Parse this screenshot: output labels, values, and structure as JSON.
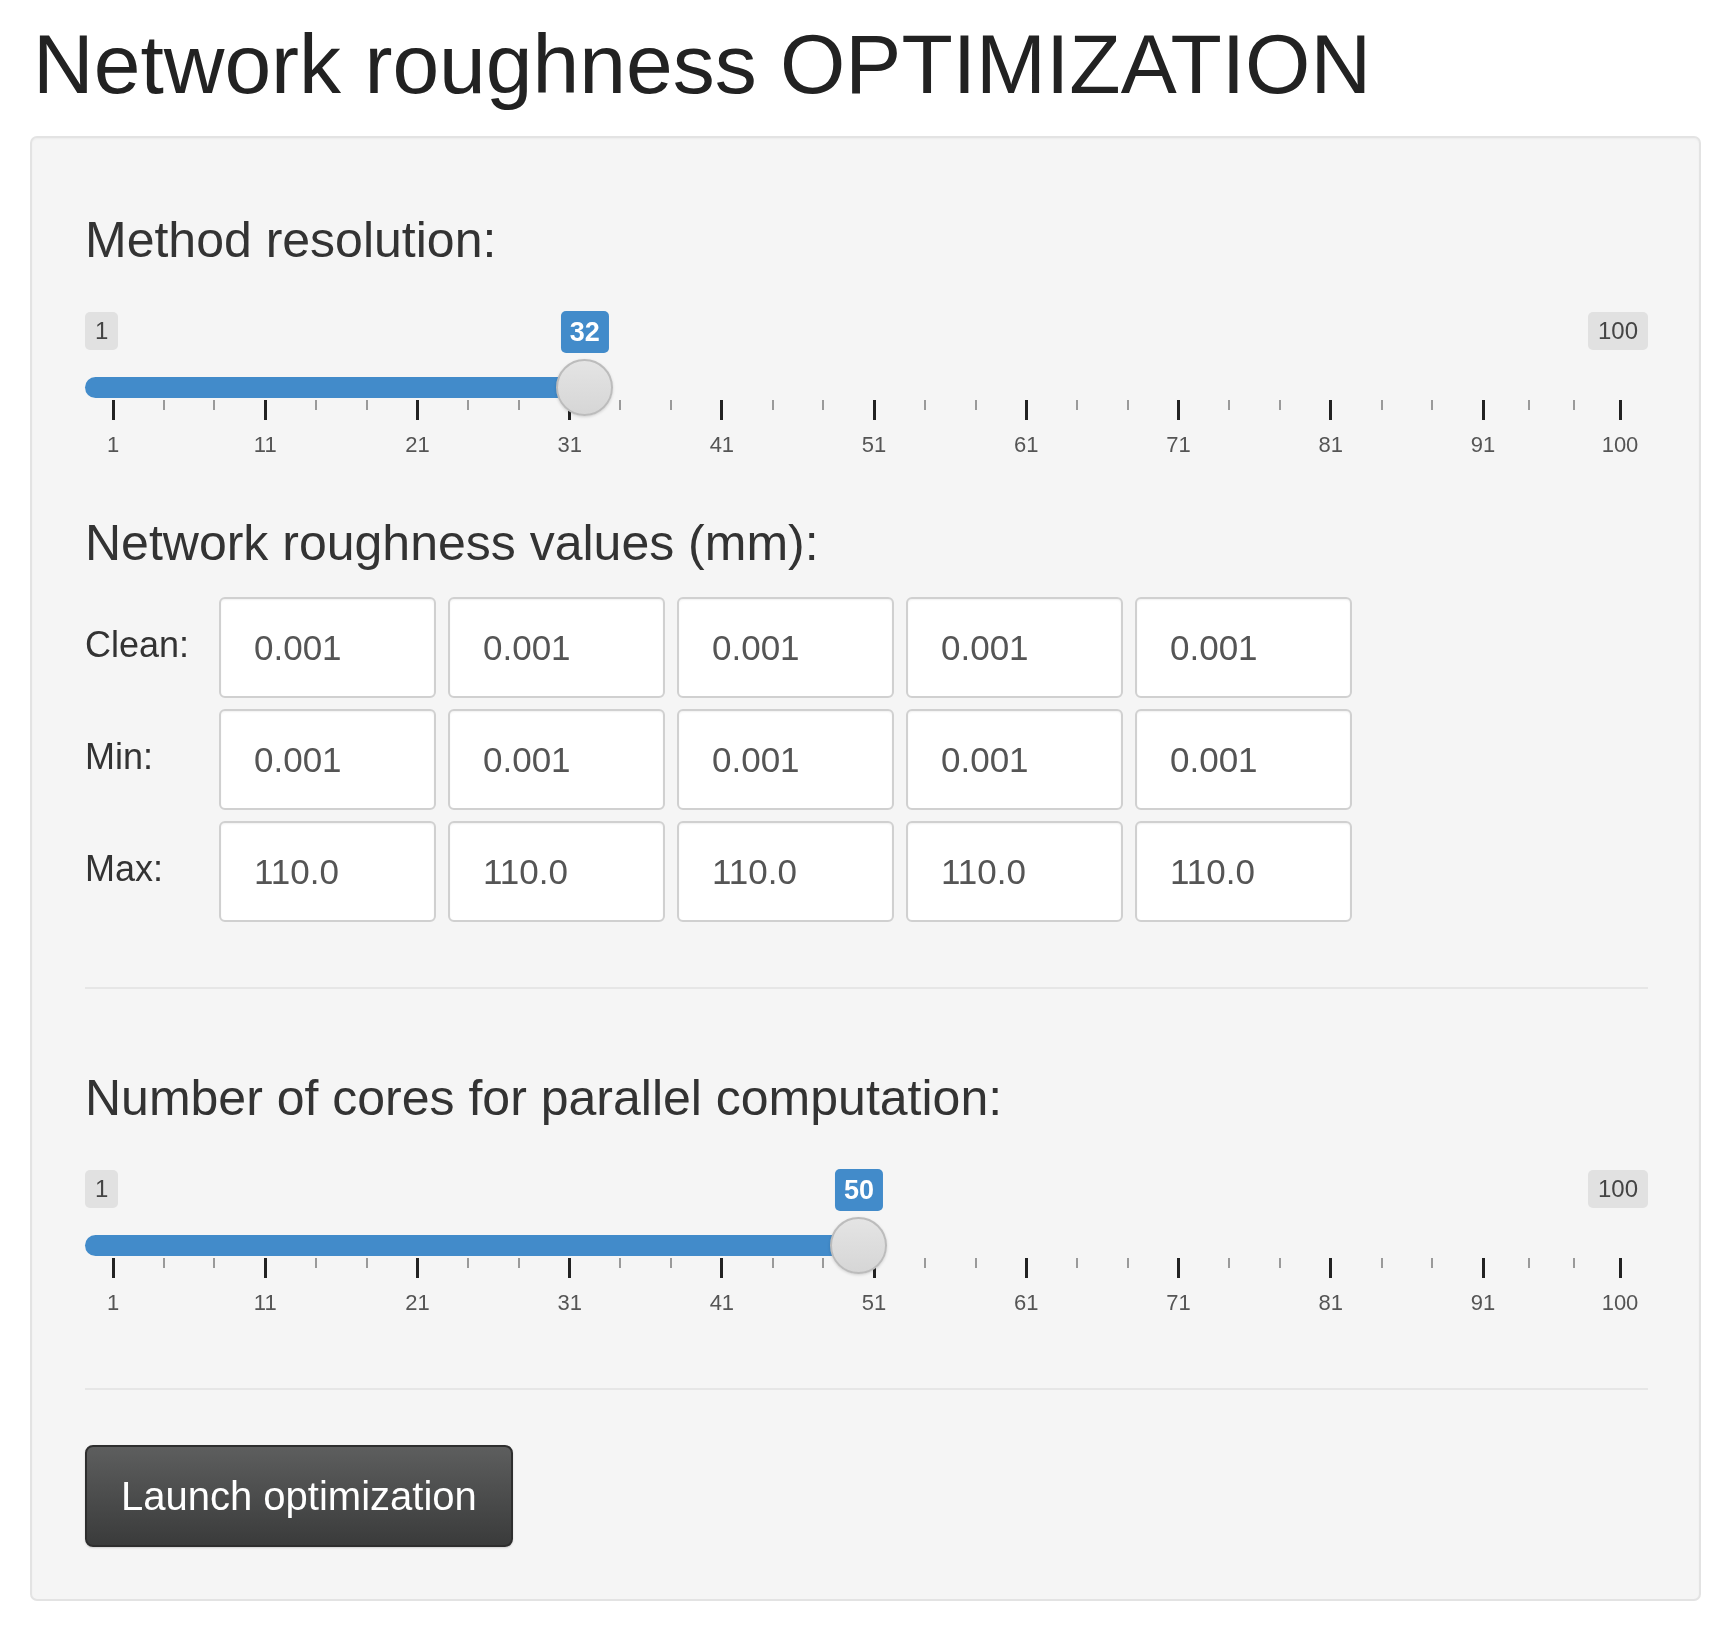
{
  "title": "Network roughness OPTIMIZATION",
  "panel": {
    "sections": [
      {
        "kind": "slider",
        "label": "Method resolution:",
        "min_label": "1",
        "max_label": "100",
        "value": "32",
        "level": 0.313,
        "ticks": [
          "1",
          "11",
          "21",
          "31",
          "41",
          "51",
          "61",
          "71",
          "81",
          "91",
          "100"
        ]
      },
      {
        "kind": "value_grid",
        "label": "Network roughness values (mm):",
        "rows": [
          {
            "label": "Clean:",
            "values": [
              "0.001",
              "0.001",
              "0.001",
              "0.001",
              "0.001"
            ]
          },
          {
            "label": "Min:",
            "values": [
              "0.001",
              "0.001",
              "0.001",
              "0.001",
              "0.001"
            ]
          },
          {
            "label": "Max:",
            "values": [
              "110.0",
              "110.0",
              "110.0",
              "110.0",
              "110.0"
            ]
          }
        ]
      },
      {
        "kind": "divider"
      },
      {
        "kind": "slider",
        "label": "Number of cores for parallel computation:",
        "min_label": "1",
        "max_label": "100",
        "value": "50",
        "level": 0.495,
        "ticks": [
          "1",
          "11",
          "21",
          "31",
          "41",
          "51",
          "61",
          "71",
          "81",
          "91",
          "100"
        ]
      },
      {
        "kind": "divider"
      },
      {
        "kind": "button",
        "label": "Launch optimization"
      }
    ]
  }
}
